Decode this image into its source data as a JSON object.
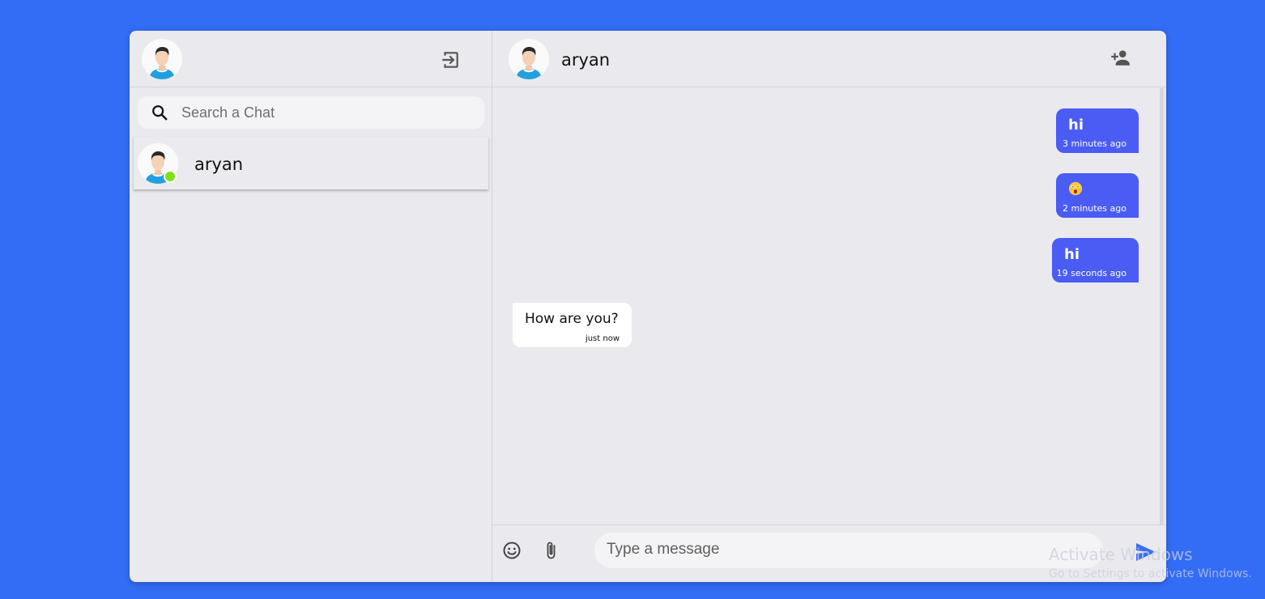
{
  "sidebar": {
    "search": {
      "placeholder": "Search a Chat"
    },
    "chats": [
      {
        "name": "aryan",
        "status": "online"
      }
    ]
  },
  "chat": {
    "header": {
      "title": "aryan"
    },
    "messages": [
      {
        "sender": "me",
        "text": "hi",
        "time": "3 minutes ago"
      },
      {
        "sender": "me",
        "text": "",
        "emoji": "astonished-face-icon",
        "time": "2 minutes ago"
      },
      {
        "sender": "me",
        "text": "hi",
        "time": "19 seconds ago"
      },
      {
        "sender": "them",
        "text": "How are you?",
        "time": "just now"
      }
    ],
    "composer": {
      "placeholder": "Type a message"
    }
  },
  "colors": {
    "background": "#336df5",
    "panel": "#eaeaee",
    "my_bubble": "#4a5cf3",
    "their_bubble": "#ffffff",
    "online_dot": "#7ee016",
    "send_icon": "#3a6ff0"
  },
  "watermark": {
    "title": "Activate Windows",
    "subtitle": "Go to Settings to activate Windows."
  }
}
